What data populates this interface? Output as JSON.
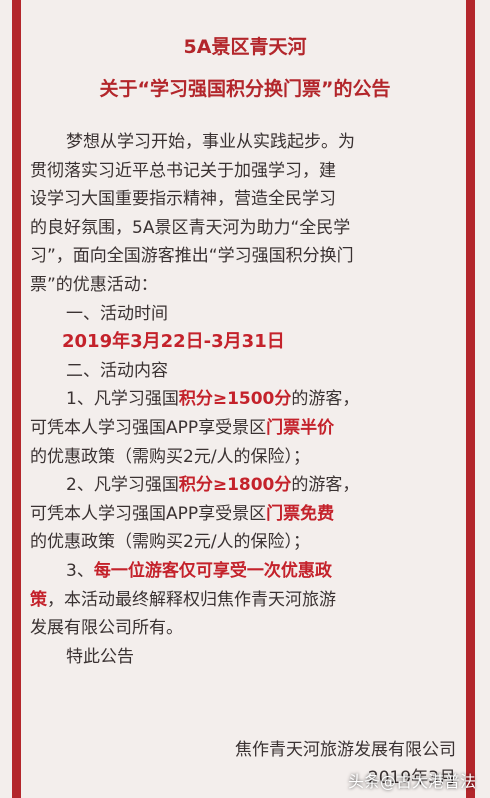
{
  "header": {
    "title1": "5A景区青天河",
    "title2": "关于“学习强国积分换门票”的公告"
  },
  "body": {
    "p1": [
      "梦想从学习开始，事业从实践起步。为",
      "贯彻落实习近平总书记关于加强学习，建",
      "设学习大国重要指示精神，营造全民学习",
      "的良好氛围，5A景区青天河为助力“全民学",
      "习”，面向全国游客推出“学习强国积分换门",
      "票”的优惠活动："
    ],
    "section1": "一、活动时间",
    "date": "2019年3月22日-3月31日",
    "section2": "二、活动内容",
    "item1": {
      "pre": "1、凡学习强国",
      "points": "积分≥1500分",
      "post": "的游客，",
      "l2pre": "可凭本人学习强国APP享受景区",
      "benefit": "门票半价",
      "l3": "的优惠政策（需购买2元/人的保险）；"
    },
    "item2": {
      "pre": "2、凡学习强国",
      "points": "积分≥1800分",
      "post": "的游客，",
      "l2pre": "可凭本人学习强国APP享受景区",
      "benefit": "门票免费",
      "l3": "的优惠政策（需购买2元/人的保险）；"
    },
    "item3": {
      "pre": "3、",
      "highlight1": "每一位游客仅可享受一次优惠政",
      "highlight2": "策",
      "l2post": "，本活动最终解释权归焦作青天河旅游",
      "l3": "发展有限公司所有。"
    },
    "closing": "特此公告"
  },
  "signature": {
    "company": "焦作青天河旅游发展有限公司",
    "date": "2019年3月"
  },
  "watermark": {
    "text": "头条@古大港普法"
  },
  "colors": {
    "accent": "#b3262b",
    "highlight": "#c4222b",
    "background": "#f3eeec"
  }
}
